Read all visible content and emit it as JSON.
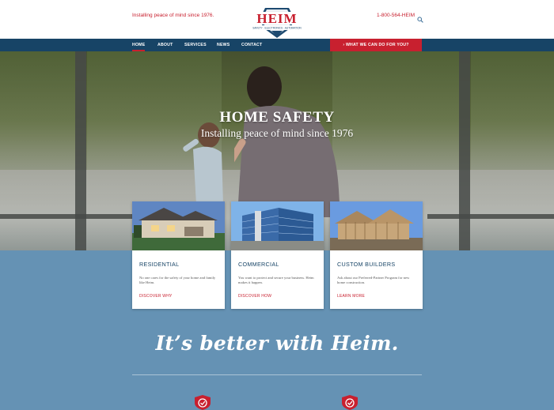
{
  "header": {
    "tagline": "Installing peace of mind since 1976.",
    "logo": {
      "name": "HEIM",
      "subtitle": "SAFETY · ELECTRONICS · AUTOMATION"
    },
    "phone": "1-800-564-HEIM",
    "search_icon": "search-icon"
  },
  "nav": {
    "items": [
      {
        "label": "HOME",
        "active": true
      },
      {
        "label": "ABOUT",
        "active": false
      },
      {
        "label": "SERVICES",
        "active": false
      },
      {
        "label": "NEWS",
        "active": false
      },
      {
        "label": "CONTACT",
        "active": false
      }
    ],
    "cta": "› WHAT WE CAN DO FOR YOU?"
  },
  "hero": {
    "title": "HOME SAFETY",
    "subtitle": "Installing peace of mind since 1976"
  },
  "cards": [
    {
      "title": "RESIDENTIAL",
      "text": "No one cares for the safety of your home and family like Heim.",
      "link": "DISCOVER WHY"
    },
    {
      "title": "COMMERCIAL",
      "text": "You want to protect and secure your business. Heim makes it happen.",
      "link": "DISCOVER HOW"
    },
    {
      "title": "CUSTOM BUILDERS",
      "text": "Ask about our Preferred-Partner Program for new home construction.",
      "link": "LEARN MORE"
    }
  ],
  "slogan": "It’s better with Heim.",
  "colors": {
    "brand_red": "#c8202f",
    "nav_blue": "#174466",
    "band_blue": "#6592b4"
  }
}
